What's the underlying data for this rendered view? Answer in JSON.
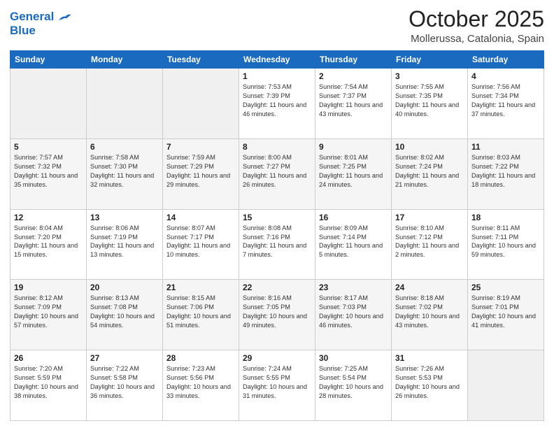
{
  "header": {
    "logo_line1": "General",
    "logo_line2": "Blue",
    "title": "October 2025",
    "subtitle": "Mollerussa, Catalonia, Spain"
  },
  "weekdays": [
    "Sunday",
    "Monday",
    "Tuesday",
    "Wednesday",
    "Thursday",
    "Friday",
    "Saturday"
  ],
  "weeks": [
    [
      {
        "day": "",
        "info": ""
      },
      {
        "day": "",
        "info": ""
      },
      {
        "day": "",
        "info": ""
      },
      {
        "day": "1",
        "info": "Sunrise: 7:53 AM\nSunset: 7:39 PM\nDaylight: 11 hours and 46 minutes."
      },
      {
        "day": "2",
        "info": "Sunrise: 7:54 AM\nSunset: 7:37 PM\nDaylight: 11 hours and 43 minutes."
      },
      {
        "day": "3",
        "info": "Sunrise: 7:55 AM\nSunset: 7:35 PM\nDaylight: 11 hours and 40 minutes."
      },
      {
        "day": "4",
        "info": "Sunrise: 7:56 AM\nSunset: 7:34 PM\nDaylight: 11 hours and 37 minutes."
      }
    ],
    [
      {
        "day": "5",
        "info": "Sunrise: 7:57 AM\nSunset: 7:32 PM\nDaylight: 11 hours and 35 minutes."
      },
      {
        "day": "6",
        "info": "Sunrise: 7:58 AM\nSunset: 7:30 PM\nDaylight: 11 hours and 32 minutes."
      },
      {
        "day": "7",
        "info": "Sunrise: 7:59 AM\nSunset: 7:29 PM\nDaylight: 11 hours and 29 minutes."
      },
      {
        "day": "8",
        "info": "Sunrise: 8:00 AM\nSunset: 7:27 PM\nDaylight: 11 hours and 26 minutes."
      },
      {
        "day": "9",
        "info": "Sunrise: 8:01 AM\nSunset: 7:25 PM\nDaylight: 11 hours and 24 minutes."
      },
      {
        "day": "10",
        "info": "Sunrise: 8:02 AM\nSunset: 7:24 PM\nDaylight: 11 hours and 21 minutes."
      },
      {
        "day": "11",
        "info": "Sunrise: 8:03 AM\nSunset: 7:22 PM\nDaylight: 11 hours and 18 minutes."
      }
    ],
    [
      {
        "day": "12",
        "info": "Sunrise: 8:04 AM\nSunset: 7:20 PM\nDaylight: 11 hours and 15 minutes."
      },
      {
        "day": "13",
        "info": "Sunrise: 8:06 AM\nSunset: 7:19 PM\nDaylight: 11 hours and 13 minutes."
      },
      {
        "day": "14",
        "info": "Sunrise: 8:07 AM\nSunset: 7:17 PM\nDaylight: 11 hours and 10 minutes."
      },
      {
        "day": "15",
        "info": "Sunrise: 8:08 AM\nSunset: 7:16 PM\nDaylight: 11 hours and 7 minutes."
      },
      {
        "day": "16",
        "info": "Sunrise: 8:09 AM\nSunset: 7:14 PM\nDaylight: 11 hours and 5 minutes."
      },
      {
        "day": "17",
        "info": "Sunrise: 8:10 AM\nSunset: 7:12 PM\nDaylight: 11 hours and 2 minutes."
      },
      {
        "day": "18",
        "info": "Sunrise: 8:11 AM\nSunset: 7:11 PM\nDaylight: 10 hours and 59 minutes."
      }
    ],
    [
      {
        "day": "19",
        "info": "Sunrise: 8:12 AM\nSunset: 7:09 PM\nDaylight: 10 hours and 57 minutes."
      },
      {
        "day": "20",
        "info": "Sunrise: 8:13 AM\nSunset: 7:08 PM\nDaylight: 10 hours and 54 minutes."
      },
      {
        "day": "21",
        "info": "Sunrise: 8:15 AM\nSunset: 7:06 PM\nDaylight: 10 hours and 51 minutes."
      },
      {
        "day": "22",
        "info": "Sunrise: 8:16 AM\nSunset: 7:05 PM\nDaylight: 10 hours and 49 minutes."
      },
      {
        "day": "23",
        "info": "Sunrise: 8:17 AM\nSunset: 7:03 PM\nDaylight: 10 hours and 46 minutes."
      },
      {
        "day": "24",
        "info": "Sunrise: 8:18 AM\nSunset: 7:02 PM\nDaylight: 10 hours and 43 minutes."
      },
      {
        "day": "25",
        "info": "Sunrise: 8:19 AM\nSunset: 7:01 PM\nDaylight: 10 hours and 41 minutes."
      }
    ],
    [
      {
        "day": "26",
        "info": "Sunrise: 7:20 AM\nSunset: 5:59 PM\nDaylight: 10 hours and 38 minutes."
      },
      {
        "day": "27",
        "info": "Sunrise: 7:22 AM\nSunset: 5:58 PM\nDaylight: 10 hours and 36 minutes."
      },
      {
        "day": "28",
        "info": "Sunrise: 7:23 AM\nSunset: 5:56 PM\nDaylight: 10 hours and 33 minutes."
      },
      {
        "day": "29",
        "info": "Sunrise: 7:24 AM\nSunset: 5:55 PM\nDaylight: 10 hours and 31 minutes."
      },
      {
        "day": "30",
        "info": "Sunrise: 7:25 AM\nSunset: 5:54 PM\nDaylight: 10 hours and 28 minutes."
      },
      {
        "day": "31",
        "info": "Sunrise: 7:26 AM\nSunset: 5:53 PM\nDaylight: 10 hours and 26 minutes."
      },
      {
        "day": "",
        "info": ""
      }
    ]
  ]
}
